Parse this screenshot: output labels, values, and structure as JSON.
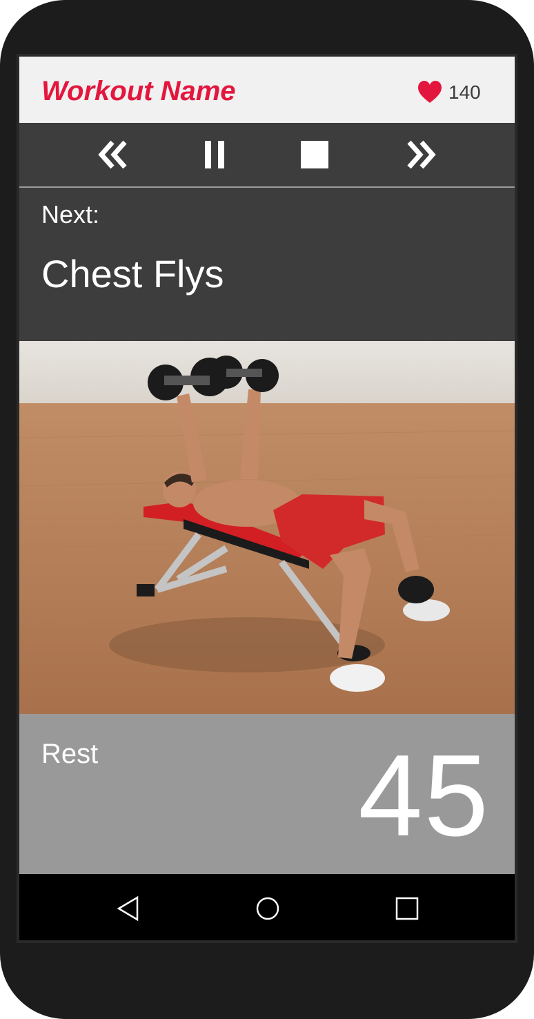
{
  "header": {
    "title": "Workout Name",
    "heart_rate": "140",
    "heart_icon": "heart-icon"
  },
  "controls": {
    "previous": "rewind-icon",
    "pause": "pause-icon",
    "stop": "stop-icon",
    "next": "fast-forward-icon"
  },
  "next_up": {
    "label": "Next:",
    "exercise": "Chest Flys"
  },
  "rest": {
    "label": "Rest",
    "seconds": "45"
  },
  "navbar": {
    "back": "back-icon",
    "home": "home-icon",
    "recents": "recents-icon"
  },
  "colors": {
    "accent": "#e3173e",
    "panel": "#3d3d3d",
    "rest_bg": "#999999",
    "header_bg": "#f1f1f1"
  }
}
